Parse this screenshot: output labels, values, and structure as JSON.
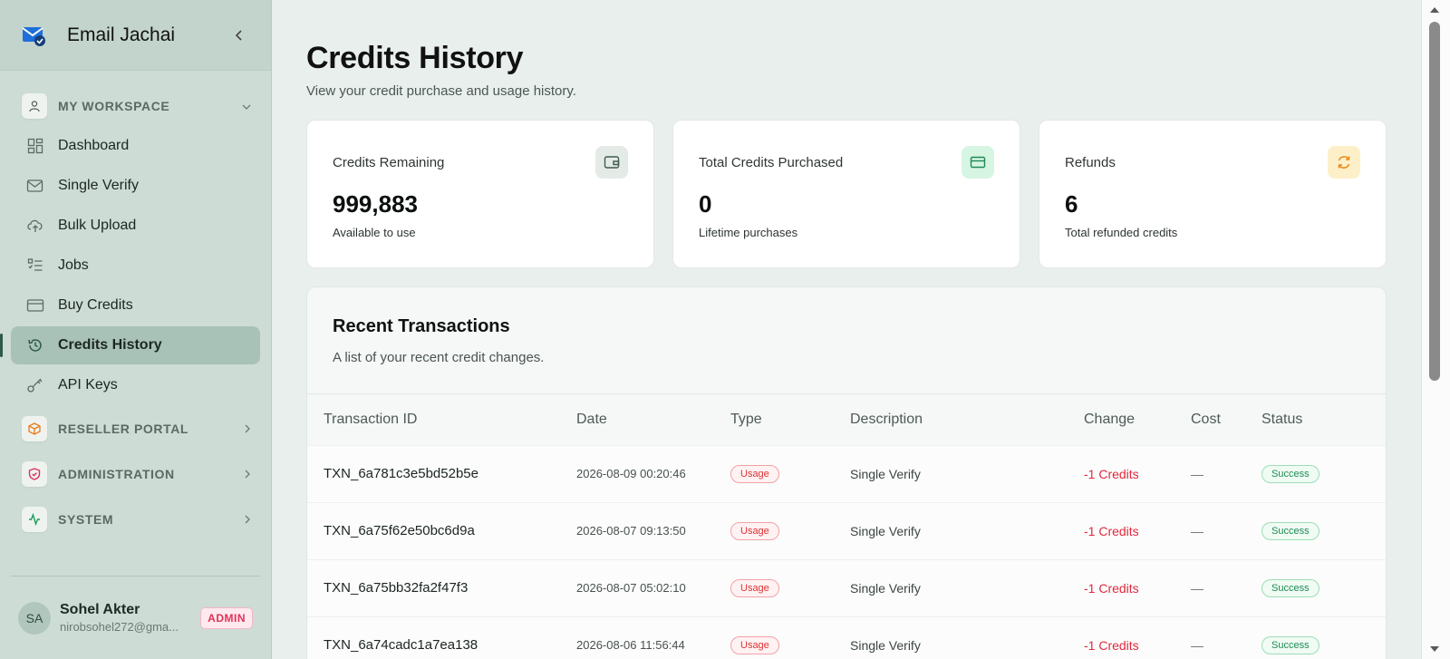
{
  "sidebar": {
    "brand": "Email Jachai",
    "sections": {
      "workspace": "MY WORKSPACE",
      "reseller": "RESELLER PORTAL",
      "administration": "ADMINISTRATION",
      "system": "SYSTEM"
    },
    "items": [
      {
        "label": "Dashboard",
        "icon": "dashboard-icon"
      },
      {
        "label": "Single Verify",
        "icon": "mail-check-icon"
      },
      {
        "label": "Bulk Upload",
        "icon": "cloud-upload-icon"
      },
      {
        "label": "Jobs",
        "icon": "list-icon"
      },
      {
        "label": "Buy Credits",
        "icon": "credit-card-icon"
      },
      {
        "label": "Credits History",
        "icon": "history-icon",
        "active": true
      },
      {
        "label": "API Keys",
        "icon": "key-icon"
      }
    ],
    "user": {
      "initials": "SA",
      "name": "Sohel Akter",
      "email": "nirobsohel272@gma...",
      "role": "ADMIN"
    }
  },
  "page": {
    "title": "Credits History",
    "subtitle": "View your credit purchase and usage history."
  },
  "cards": [
    {
      "label": "Credits Remaining",
      "value": "999,883",
      "note": "Available to use",
      "icon": "wallet-icon",
      "color": "#e4ebe7"
    },
    {
      "label": "Total Credits Purchased",
      "value": "0",
      "note": "Lifetime purchases",
      "icon": "credit-card-icon",
      "color": "#d6f5e2"
    },
    {
      "label": "Refunds",
      "value": "6",
      "note": "Total refunded credits",
      "icon": "refresh-icon",
      "color": "#fdf0c9"
    }
  ],
  "transactions": {
    "title": "Recent Transactions",
    "subtitle": "A list of your recent credit changes.",
    "columns": [
      "Transaction ID",
      "Date",
      "Type",
      "Description",
      "Change",
      "Cost",
      "Status"
    ],
    "rows": [
      {
        "id": "TXN_6a781c3e5bd52b5e",
        "date": "2026-08-09 00:20:46",
        "type": "Usage",
        "description": "Single Verify",
        "change": "-1 Credits",
        "cost": "—",
        "status": "Success"
      },
      {
        "id": "TXN_6a75f62e50bc6d9a",
        "date": "2026-08-07 09:13:50",
        "type": "Usage",
        "description": "Single Verify",
        "change": "-1 Credits",
        "cost": "—",
        "status": "Success"
      },
      {
        "id": "TXN_6a75bb32fa2f47f3",
        "date": "2026-08-07 05:02:10",
        "type": "Usage",
        "description": "Single Verify",
        "change": "-1 Credits",
        "cost": "—",
        "status": "Success"
      },
      {
        "id": "TXN_6a74cadc1a7ea138",
        "date": "2026-08-06 11:56:44",
        "type": "Usage",
        "description": "Single Verify",
        "change": "-1 Credits",
        "cost": "—",
        "status": "Success"
      }
    ]
  },
  "colors": {
    "accent": "#2f5a4a",
    "negative": "#e3283f",
    "success": "#1f8a55",
    "sidebar_bg": "#cddcd5"
  }
}
